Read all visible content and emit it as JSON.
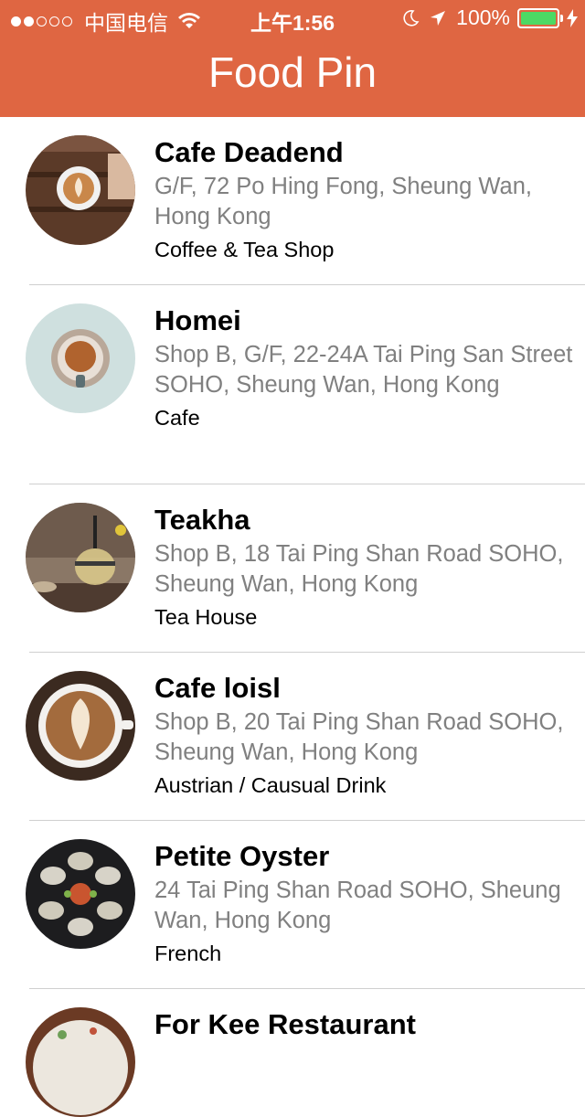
{
  "status_bar": {
    "carrier": "中国电信",
    "time": "上午1:56",
    "battery": "100%",
    "signal_filled": 2,
    "signal_total": 5
  },
  "nav": {
    "title": "Food Pin",
    "color": "#df6642"
  },
  "restaurants": [
    {
      "name": "Cafe Deadend",
      "address": "G/F, 72 Po Hing Fong, Sheung Wan, Hong Kong",
      "type": "Coffee & Tea Shop"
    },
    {
      "name": "Homei",
      "address": "Shop B, G/F, 22-24A Tai Ping San Street SOHO, Sheung Wan, Hong Kong",
      "type": "Cafe"
    },
    {
      "name": "Teakha",
      "address": "Shop B, 18 Tai Ping Shan Road SOHO, Sheung Wan, Hong Kong",
      "type": "Tea House"
    },
    {
      "name": "Cafe loisl",
      "address": "Shop B, 20 Tai Ping Shan Road SOHO, Sheung Wan, Hong Kong",
      "type": "Austrian / Causual Drink"
    },
    {
      "name": "Petite Oyster",
      "address": "24 Tai Ping Shan Road SOHO, Sheung Wan, Hong Kong",
      "type": "French"
    },
    {
      "name": "For Kee Restaurant",
      "address": "",
      "type": ""
    }
  ]
}
